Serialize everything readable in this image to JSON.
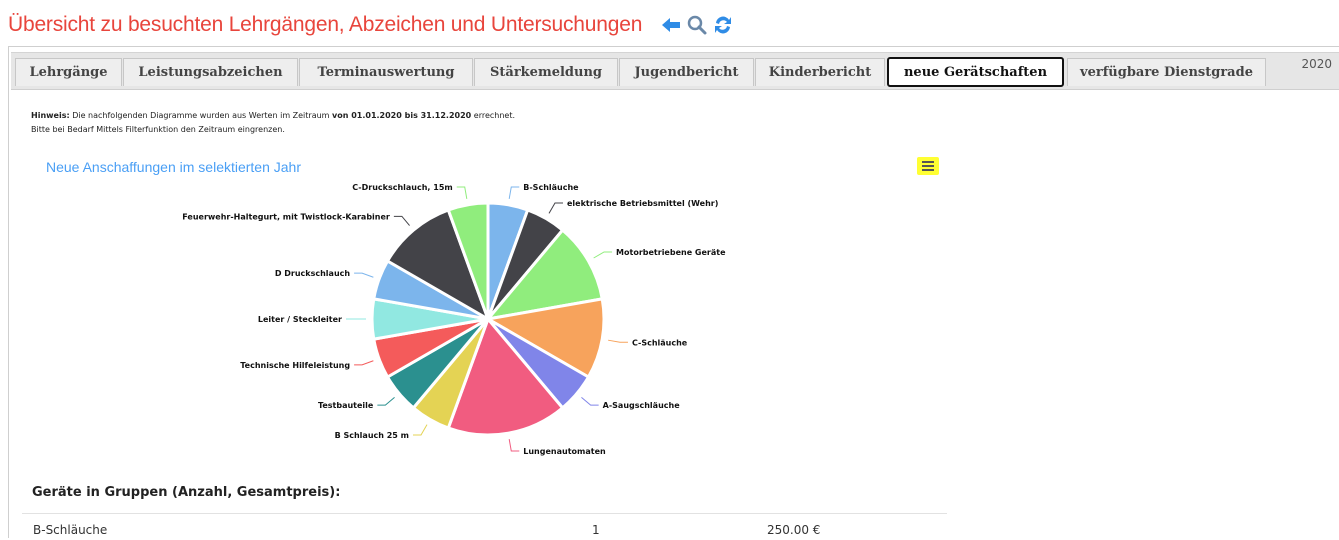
{
  "header": {
    "title": "Übersicht zu besuchten Lehrgängen, Abzeichen und Untersuchungen",
    "icons": [
      "back-arrow-icon",
      "search-icon",
      "refresh-icon"
    ]
  },
  "tabs": [
    {
      "label": "Lehrgänge",
      "active": false
    },
    {
      "label": "Leistungsabzeichen",
      "active": false
    },
    {
      "label": "Terminauswertung",
      "active": false
    },
    {
      "label": "Stärkemeldung",
      "active": false
    },
    {
      "label": "Jugendbericht",
      "active": false
    },
    {
      "label": "Kinderbericht",
      "active": false
    },
    {
      "label": "neue Gerätschaften",
      "active": true
    },
    {
      "label": "verfügbare Dienstgrade",
      "active": false
    }
  ],
  "year": "2020",
  "hint": {
    "prefix": "Hinweis:",
    "text1": " Die nachfolgenden Diagramme wurden aus Werten im Zeitraum ",
    "range": "von 01.01.2020 bis 31.12.2020",
    "text2": " errechnet.",
    "line2": "Bitte bei Bedarf Mittels Filterfunktion den Zeitraum eingrenzen."
  },
  "chart_data": {
    "type": "pie",
    "title": "Neue Anschaffungen im selektierten Jahr",
    "slices": [
      {
        "label": "B-Schläuche",
        "value": 1,
        "color": "#7cb5ec"
      },
      {
        "label": "elektrische Betriebsmittel (Wehr)",
        "value": 1,
        "color": "#434348"
      },
      {
        "label": "Motorbetriebene Geräte",
        "value": 2,
        "color": "#90ed7d"
      },
      {
        "label": "C-Schläuche",
        "value": 2,
        "color": "#f7a35c"
      },
      {
        "label": "A-Saugschläuche",
        "value": 1,
        "color": "#8085e9"
      },
      {
        "label": "Lungenautomaten",
        "value": 3,
        "color": "#f15c80"
      },
      {
        "label": "B Schlauch 25 m",
        "value": 1,
        "color": "#e4d354"
      },
      {
        "label": "Testbauteile",
        "value": 1,
        "color": "#2b908f"
      },
      {
        "label": "Technische Hilfeleistung",
        "value": 1,
        "color": "#f45b5b"
      },
      {
        "label": "Leiter / Steckleiter",
        "value": 1,
        "color": "#91e8e1"
      },
      {
        "label": "D Druckschlauch",
        "value": 1,
        "color": "#7cb5ec"
      },
      {
        "label": "Feuerwehr-Haltegurt, mit Twistlock-Karabiner",
        "value": 2,
        "color": "#434348"
      },
      {
        "label": "C-Druckschlauch, 15m",
        "value": 1,
        "color": "#90ed7d"
      }
    ]
  },
  "groups": {
    "heading": "Geräte in Gruppen (Anzahl, Gesamtpreis):",
    "rows": [
      {
        "name": "B-Schläuche",
        "count": "1",
        "price": "250.00 €"
      }
    ]
  }
}
